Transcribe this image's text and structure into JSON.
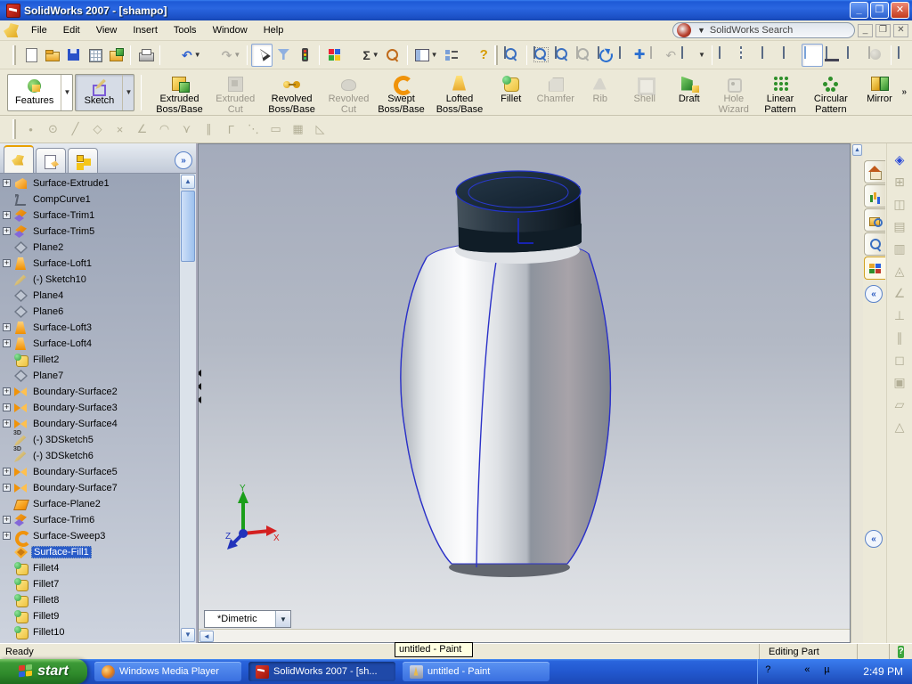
{
  "window": {
    "title": "SolidWorks 2007 - [shampo]",
    "minimize": "_",
    "restore": "❐",
    "close": "✕"
  },
  "menu": {
    "items": [
      "File",
      "Edit",
      "View",
      "Insert",
      "Tools",
      "Window",
      "Help"
    ],
    "search_placeholder": "SolidWorks Search",
    "doc_controls": {
      "minimize": "_",
      "restore": "❐",
      "close": "✕"
    }
  },
  "standard_toolbar": [
    {
      "name": "new-button",
      "icon": "new-doc-icon",
      "enabled": true
    },
    {
      "name": "open-button",
      "icon": "open-folder-icon",
      "enabled": true
    },
    {
      "name": "save-button",
      "icon": "save-icon",
      "enabled": true
    },
    {
      "name": "make-drawing-button",
      "icon": "make-drawing-icon",
      "enabled": true
    },
    {
      "name": "make-assembly-button",
      "icon": "make-assembly-icon",
      "enabled": true
    },
    {
      "name": "sep1",
      "icon": "separator"
    },
    {
      "name": "print-button",
      "icon": "print-icon",
      "enabled": true
    },
    {
      "name": "sep2",
      "icon": "separator"
    },
    {
      "name": "undo-button",
      "icon": "undo-icon",
      "glyph": "↶",
      "enabled": true,
      "dropdown": true
    },
    {
      "name": "redo-button",
      "icon": "redo-icon",
      "glyph": "↷",
      "enabled": false,
      "dropdown": true
    },
    {
      "name": "sep3",
      "icon": "separator"
    },
    {
      "name": "select-button",
      "icon": "select-cursor-icon",
      "enabled": true,
      "active": true
    },
    {
      "name": "selection-filter-button",
      "icon": "selection-filter-icon",
      "enabled": true
    },
    {
      "name": "rebuild-button",
      "icon": "traffic-light-icon",
      "enabled": true
    },
    {
      "name": "sep4",
      "icon": "separator"
    },
    {
      "name": "color-swatch-button",
      "icon": "color-swatch-icon",
      "enabled": true
    },
    {
      "name": "equations-button",
      "icon": "sigma-icon",
      "glyph": "Σ",
      "enabled": true,
      "dropdown": true
    },
    {
      "name": "design-check-button",
      "icon": "design-check-icon",
      "enabled": true
    },
    {
      "name": "sep5",
      "icon": "separator"
    },
    {
      "name": "panels-button",
      "icon": "panels-icon",
      "enabled": true,
      "dropdown": true
    },
    {
      "name": "options-button",
      "icon": "options-icon",
      "enabled": true
    },
    {
      "name": "help-button",
      "icon": "help-icon",
      "glyph": "?",
      "enabled": true
    }
  ],
  "view_toolbar": [
    {
      "name": "zoom-fit-button",
      "icon": "zoom-fit-icon",
      "enabled": true
    },
    {
      "name": "sep1",
      "icon": "separator"
    },
    {
      "name": "zoom-area-button",
      "icon": "zoom-area-icon",
      "enabled": true
    },
    {
      "name": "zoom-inout-button",
      "icon": "zoom-inout-icon",
      "enabled": true
    },
    {
      "name": "zoom-selection-button",
      "icon": "zoom-selection-icon",
      "enabled": false
    },
    {
      "name": "rotate-view-button",
      "icon": "rotate-view-icon",
      "enabled": true
    },
    {
      "name": "pan-button",
      "icon": "pan-icon",
      "glyph": "✚",
      "enabled": true
    },
    {
      "name": "previous-view-button",
      "icon": "previous-view-icon",
      "glyph": "↶",
      "enabled": false
    },
    {
      "name": "standard-views-button",
      "icon": "std-views-icon",
      "enabled": true,
      "dropdown": true
    },
    {
      "name": "sep2",
      "icon": "separator"
    },
    {
      "name": "wireframe-button",
      "icon": "wireframe-cube-icon",
      "enabled": true
    },
    {
      "name": "hidden-lines-visible-button",
      "icon": "hlv-cube-icon",
      "enabled": true
    },
    {
      "name": "hidden-lines-removed-button",
      "icon": "hlr-cube-icon",
      "enabled": true
    },
    {
      "name": "shaded-with-edges-button",
      "icon": "shaded-edges-cube-icon",
      "enabled": true
    },
    {
      "name": "shaded-button",
      "icon": "shaded-cube-icon",
      "enabled": true,
      "active": true
    },
    {
      "name": "shadows-button",
      "icon": "shadow-cube-icon",
      "enabled": true
    },
    {
      "name": "section-view-button",
      "icon": "section-view-icon",
      "enabled": true
    },
    {
      "name": "curvature-button",
      "icon": "curvature-icon",
      "enabled": false
    },
    {
      "name": "sep3",
      "icon": "separator"
    },
    {
      "name": "edrawings-button",
      "icon": "edrawings-icon",
      "glyph": "e",
      "enabled": true
    },
    {
      "name": "realview-button",
      "icon": "realview-icon",
      "glyph": "⇄",
      "enabled": true
    }
  ],
  "command_manager": {
    "mode_buttons": [
      {
        "name": "features-mode-button",
        "label": "Features",
        "icon": "features-mode-icon",
        "active": false,
        "caret": "▼"
      },
      {
        "name": "sketch-mode-button",
        "label": "Sketch",
        "icon": "sketch-mode-icon",
        "active": true,
        "caret": "▼"
      }
    ],
    "buttons": [
      {
        "name": "extruded-boss-button",
        "label": "Extruded Boss/Base",
        "icon": "extruded-boss-icon",
        "enabled": true
      },
      {
        "name": "extruded-cut-button",
        "label": "Extruded Cut",
        "icon": "extruded-cut-icon",
        "enabled": false
      },
      {
        "name": "revolved-boss-button",
        "label": "Revolved Boss/Base",
        "icon": "revolved-boss-icon",
        "enabled": true
      },
      {
        "name": "revolved-cut-button",
        "label": "Revolved Cut",
        "icon": "revolved-cut-icon",
        "enabled": false
      },
      {
        "name": "swept-boss-button",
        "label": "Swept Boss/Base",
        "icon": "swept-boss-icon",
        "enabled": true
      },
      {
        "name": "lofted-boss-button",
        "label": "Lofted Boss/Base",
        "icon": "lofted-boss-icon",
        "enabled": true
      },
      {
        "name": "fillet-button",
        "label": "Fillet",
        "icon": "fillet-cmd-icon",
        "enabled": true
      },
      {
        "name": "chamfer-button",
        "label": "Chamfer",
        "icon": "chamfer-icon",
        "enabled": false
      },
      {
        "name": "rib-button",
        "label": "Rib",
        "icon": "rib-icon",
        "enabled": false
      },
      {
        "name": "shell-button",
        "label": "Shell",
        "icon": "shell-icon",
        "enabled": false
      },
      {
        "name": "draft-button",
        "label": "Draft",
        "icon": "draft-icon",
        "enabled": true
      },
      {
        "name": "hole-wizard-button",
        "label": "Hole Wizard",
        "icon": "hole-wizard-icon",
        "enabled": false
      },
      {
        "name": "linear-pattern-button",
        "label": "Linear Pattern",
        "icon": "linear-pattern-icon",
        "enabled": true
      },
      {
        "name": "circular-pattern-button",
        "label": "Circular Pattern",
        "icon": "circular-pattern-icon",
        "enabled": true
      },
      {
        "name": "mirror-button",
        "label": "Mirror",
        "icon": "mirror-cmd-icon",
        "enabled": true
      }
    ],
    "overflow_chevron": "»"
  },
  "sketch_toolbar": [
    {
      "name": "point-tool",
      "glyph": "•"
    },
    {
      "name": "circle-tool",
      "glyph": "⊙"
    },
    {
      "name": "line-tool",
      "glyph": "╱"
    },
    {
      "name": "polygon-tool",
      "glyph": "◇"
    },
    {
      "name": "trim-tool",
      "glyph": "×"
    },
    {
      "name": "angle-tool",
      "glyph": "∠"
    },
    {
      "name": "arc-tool",
      "glyph": "◠"
    },
    {
      "name": "mirror-tool",
      "glyph": "⋎"
    },
    {
      "name": "parallel-tool",
      "glyph": "∥"
    },
    {
      "name": "perpendicular-tool",
      "glyph": "Γ"
    },
    {
      "name": "points-tool",
      "glyph": "⋱"
    },
    {
      "name": "dimension-tool",
      "glyph": "▭"
    },
    {
      "name": "grid-tool",
      "glyph": "▦"
    },
    {
      "name": "triangle-tool",
      "glyph": "◺"
    }
  ],
  "feature_tree": {
    "tabs": [
      {
        "name": "featuremanager-tab",
        "icon": "featuremanager-icon",
        "active": true
      },
      {
        "name": "propertymanager-tab",
        "icon": "propertymanager-icon",
        "active": false
      },
      {
        "name": "configmanager-tab",
        "icon": "configmanager-icon",
        "active": false
      }
    ],
    "expand_chevron": "»",
    "items": [
      {
        "name": "tree-item-surface-extrude1",
        "label": "Surface-Extrude1",
        "icon": "surface-extrude",
        "plus": true
      },
      {
        "name": "tree-item-compcurve1",
        "label": "CompCurve1",
        "icon": "compcurve"
      },
      {
        "name": "tree-item-surface-trim1",
        "label": "Surface-Trim1",
        "icon": "surface-trim",
        "plus": true
      },
      {
        "name": "tree-item-surface-trim5",
        "label": "Surface-Trim5",
        "icon": "surface-trim",
        "plus": true
      },
      {
        "name": "tree-item-plane2",
        "label": "Plane2",
        "icon": "plane"
      },
      {
        "name": "tree-item-surface-loft1",
        "label": "Surface-Loft1",
        "icon": "surface-loft",
        "plus": true
      },
      {
        "name": "tree-item-sketch10",
        "label": "(-) Sketch10",
        "icon": "sketch"
      },
      {
        "name": "tree-item-plane4",
        "label": "Plane4",
        "icon": "plane"
      },
      {
        "name": "tree-item-plane6",
        "label": "Plane6",
        "icon": "plane"
      },
      {
        "name": "tree-item-surface-loft3",
        "label": "Surface-Loft3",
        "icon": "surface-loft",
        "plus": true
      },
      {
        "name": "tree-item-surface-loft4",
        "label": "Surface-Loft4",
        "icon": "surface-loft",
        "plus": true
      },
      {
        "name": "tree-item-fillet2",
        "label": "Fillet2",
        "icon": "fillet"
      },
      {
        "name": "tree-item-plane7",
        "label": "Plane7",
        "icon": "plane"
      },
      {
        "name": "tree-item-boundary-surface2",
        "label": "Boundary-Surface2",
        "icon": "boundary",
        "plus": true
      },
      {
        "name": "tree-item-boundary-surface3",
        "label": "Boundary-Surface3",
        "icon": "boundary",
        "plus": true
      },
      {
        "name": "tree-item-boundary-surface4",
        "label": "Boundary-Surface4",
        "icon": "boundary",
        "plus": true
      },
      {
        "name": "tree-item-3dsketch5",
        "label": "(-) 3DSketch5",
        "icon": "sketch3d"
      },
      {
        "name": "tree-item-3dsketch6",
        "label": "(-) 3DSketch6",
        "icon": "sketch3d"
      },
      {
        "name": "tree-item-boundary-surface5",
        "label": "Boundary-Surface5",
        "icon": "boundary",
        "plus": true
      },
      {
        "name": "tree-item-boundary-surface7",
        "label": "Boundary-Surface7",
        "icon": "boundary",
        "plus": true
      },
      {
        "name": "tree-item-surface-plane2",
        "label": "Surface-Plane2",
        "icon": "surface-plane"
      },
      {
        "name": "tree-item-surface-trim6",
        "label": "Surface-Trim6",
        "icon": "surface-trim",
        "plus": true
      },
      {
        "name": "tree-item-surface-sweep3",
        "label": "Surface-Sweep3",
        "icon": "surface-sweep",
        "plus": true
      },
      {
        "name": "tree-item-surface-fill1",
        "label": "Surface-Fill1",
        "icon": "surface-fill",
        "selected": true
      },
      {
        "name": "tree-item-fillet4",
        "label": "Fillet4",
        "icon": "fillet"
      },
      {
        "name": "tree-item-fillet7",
        "label": "Fillet7",
        "icon": "fillet"
      },
      {
        "name": "tree-item-fillet8",
        "label": "Fillet8",
        "icon": "fillet"
      },
      {
        "name": "tree-item-fillet9",
        "label": "Fillet9",
        "icon": "fillet"
      },
      {
        "name": "tree-item-fillet10",
        "label": "Fillet10",
        "icon": "fillet"
      }
    ]
  },
  "viewport": {
    "view_name": "*Dimetric",
    "combo_caret": "▼",
    "triad": {
      "x": "X",
      "y": "Y",
      "z": "Z"
    },
    "scroll_left_arrow": "◄",
    "scroll_up_arrow": "▲"
  },
  "task_pane": {
    "tabs": [
      {
        "name": "home-tab",
        "icon": "home-icon",
        "active": false
      },
      {
        "name": "design-library-tab",
        "icon": "design-library-icon",
        "active": false
      },
      {
        "name": "file-explorer-tab",
        "icon": "file-explorer-icon",
        "active": false
      },
      {
        "name": "search-tab",
        "icon": "search-icon",
        "active": false
      },
      {
        "name": "custom-properties-tab",
        "icon": "palette-icon",
        "active": true
      }
    ],
    "collapse_chevron": "«"
  },
  "right_toolbar": [
    {
      "name": "smart-dimension-button",
      "glyph": "◈",
      "blue": true
    },
    {
      "name": "horizontal-dimension-button",
      "glyph": "⊞"
    },
    {
      "name": "vertical-dimension-button",
      "glyph": "◫"
    },
    {
      "name": "baseline-dimension-button",
      "glyph": "▤"
    },
    {
      "name": "note-button",
      "glyph": "▥"
    },
    {
      "name": "balloon-button",
      "glyph": "◬"
    },
    {
      "name": "surface-finish-button",
      "glyph": "∠"
    },
    {
      "name": "geometric-tolerance-button",
      "glyph": "⊥"
    },
    {
      "name": "datum-feature-button",
      "glyph": "∥"
    },
    {
      "name": "weld-symbol-button",
      "glyph": "◻"
    },
    {
      "name": "center-mark-button",
      "glyph": "▣"
    },
    {
      "name": "area-hatch-button",
      "glyph": "▱"
    },
    {
      "name": "table-button",
      "glyph": "△"
    }
  ],
  "status_bar": {
    "left": "Ready",
    "tooltip": "untitled - Paint",
    "mode": "Editing Part",
    "help_glyph": "?"
  },
  "taskbar": {
    "start_label": "start",
    "buttons": [
      {
        "name": "taskbar-wmp-button",
        "label": "Windows Media Player",
        "icon": "wmp-icon",
        "active": false
      },
      {
        "name": "taskbar-solidworks-button",
        "label": "SolidWorks 2007 - [sh...",
        "icon": "solidworks-icon",
        "active": true
      },
      {
        "name": "taskbar-paint-button",
        "label": "untitled - Paint",
        "icon": "paint-icon",
        "active": false
      }
    ],
    "tray_icons": [
      {
        "name": "tray-help-icon",
        "glyph": "?"
      },
      {
        "name": "tray-restore-icon",
        "glyph": ""
      },
      {
        "name": "tray-collapse-icon",
        "glyph": "«"
      },
      {
        "name": "utorrent-icon",
        "glyph": "µ"
      },
      {
        "name": "tray-search-icon",
        "glyph": ""
      }
    ],
    "clock": "2:49 PM"
  },
  "colors": {
    "titlebar_blue": "#2a66e0",
    "toolbar_beige": "#ece9d8",
    "tree_gradient_top": "#97a1b4",
    "selection_blue": "#2a5cc8",
    "taskbar_blue": "#2258cf",
    "start_green": "#2f8a2b",
    "cap_dark": "#16222c",
    "edge_blue": "#2b31c8"
  }
}
